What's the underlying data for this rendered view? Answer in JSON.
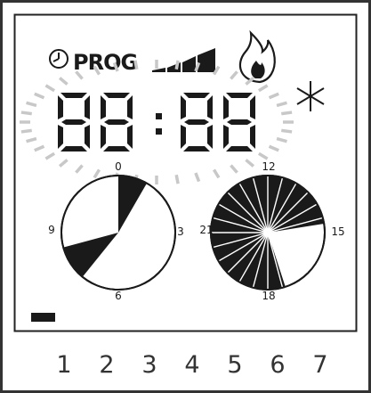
{
  "display": {
    "prog_label": "PROG",
    "time_digits": [
      "8",
      "8",
      "8",
      "8"
    ],
    "colors": {
      "ink": "#1a1a1a",
      "halo": "#c8c8c8",
      "outer_frame": "#333333"
    },
    "icons": {
      "clock": "clock-icon",
      "signal": "signal-strength-icon",
      "flame": "flame-icon",
      "frost": "snowflake-icon",
      "battery": "battery-icon"
    },
    "signal_level": "4 of 4 bars"
  },
  "dial_left": {
    "labels": {
      "top": "0",
      "right": "3",
      "bottom": "6",
      "left": "9"
    },
    "hours_per_turn": 12,
    "black_sectors": [
      [
        0,
        1
      ],
      [
        7.3,
        8.5
      ]
    ]
  },
  "dial_right": {
    "labels": {
      "top": "12",
      "right": "15",
      "bottom": "18",
      "left": "21"
    },
    "hours_per_turn": 12,
    "black_sectors": [
      [
        12,
        14.7
      ],
      [
        17.4,
        24
      ]
    ],
    "divisions": 24
  },
  "days": [
    "1",
    "2",
    "3",
    "4",
    "5",
    "6",
    "7"
  ]
}
